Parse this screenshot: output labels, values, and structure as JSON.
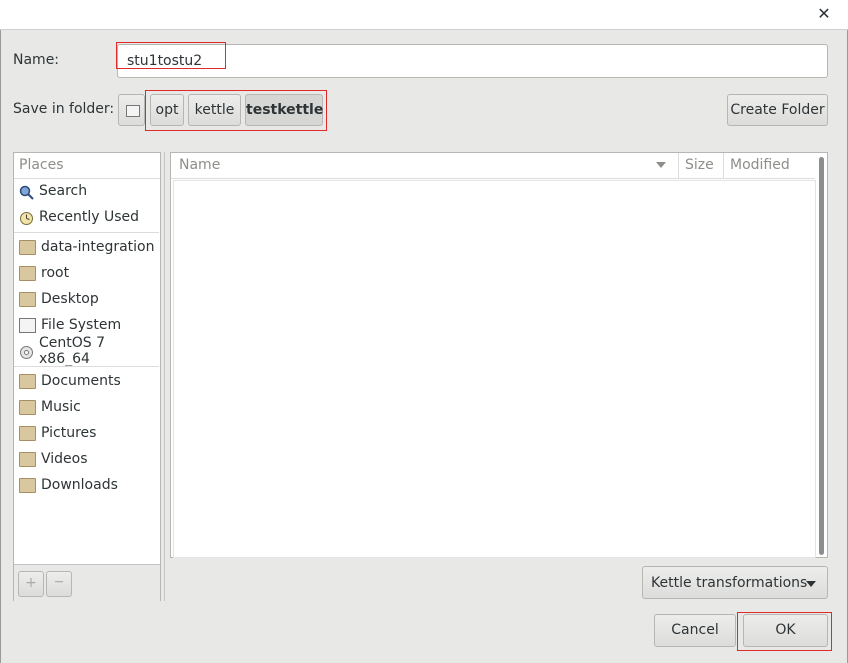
{
  "name_label": "Name:",
  "name_value": "stu1tostu2",
  "save_in_label": "Save in folder:",
  "path": [
    "opt",
    "kettle",
    "testkettle"
  ],
  "create_folder": "Create Folder",
  "places_header": "Places",
  "places": [
    {
      "label": "Search",
      "icon": "search-icon"
    },
    {
      "label": "Recently Used",
      "icon": "clock-icon"
    },
    {
      "label": "data-integration",
      "icon": "folder-icon"
    },
    {
      "label": "root",
      "icon": "home-folder-icon"
    },
    {
      "label": "Desktop",
      "icon": "desktop-folder-icon"
    },
    {
      "label": "File System",
      "icon": "drive-icon"
    },
    {
      "label": "CentOS 7 x86_64",
      "icon": "disc-icon"
    },
    {
      "label": "Documents",
      "icon": "documents-folder-icon"
    },
    {
      "label": "Music",
      "icon": "music-folder-icon"
    },
    {
      "label": "Pictures",
      "icon": "pictures-folder-icon"
    },
    {
      "label": "Videos",
      "icon": "videos-folder-icon"
    },
    {
      "label": "Downloads",
      "icon": "downloads-folder-icon"
    }
  ],
  "columns": {
    "name": "Name",
    "size": "Size",
    "modified": "Modified"
  },
  "add_symbol": "+",
  "remove_symbol": "—",
  "filter": "Kettle transformations",
  "cancel": "Cancel",
  "ok": "OK",
  "colors": {
    "dialog_bg": "#e8e8e7",
    "highlight_border": "#e02a2a"
  }
}
